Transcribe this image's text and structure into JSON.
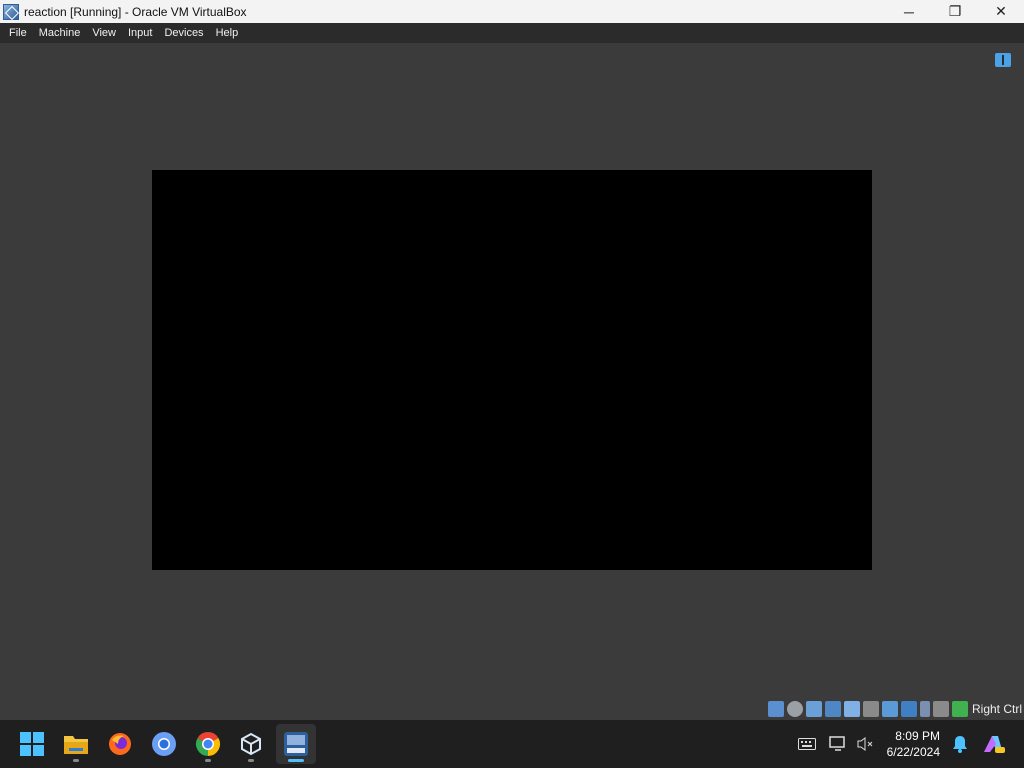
{
  "window": {
    "title": "reaction [Running] - Oracle VM VirtualBox",
    "controls": {
      "minimize": "─",
      "restore": "❐",
      "close": "✕"
    }
  },
  "menu": {
    "items": [
      "File",
      "Machine",
      "View",
      "Input",
      "Devices",
      "Help"
    ]
  },
  "statusbar": {
    "icons": [
      "hard-disk-icon",
      "optical-drive-icon",
      "audio-icon",
      "network-icon",
      "usb-icon",
      "shared-folders-icon",
      "display-icon",
      "video-capture-icon",
      "virtualization-icon",
      "mouse-integration-icon",
      "keyboard-capture-icon"
    ],
    "host_key": "Right Ctrl"
  },
  "taskbar": {
    "apps": [
      {
        "name": "start-button",
        "label": "Start"
      },
      {
        "name": "file-explorer",
        "label": "File Explorer"
      },
      {
        "name": "firefox",
        "label": "Firefox"
      },
      {
        "name": "chromium",
        "label": "Chromium"
      },
      {
        "name": "chrome",
        "label": "Google Chrome"
      },
      {
        "name": "virtualbox",
        "label": "Oracle VM VirtualBox"
      },
      {
        "name": "vm-window",
        "label": "reaction [Running]"
      }
    ],
    "clock": {
      "time": "8:09 PM",
      "date": "6/22/2024"
    }
  },
  "colors": {
    "vm_background": "#3b3b3b",
    "guest_screen": "#000000",
    "taskbar": "#1f1f1f",
    "accent": "#4cc2ff"
  }
}
